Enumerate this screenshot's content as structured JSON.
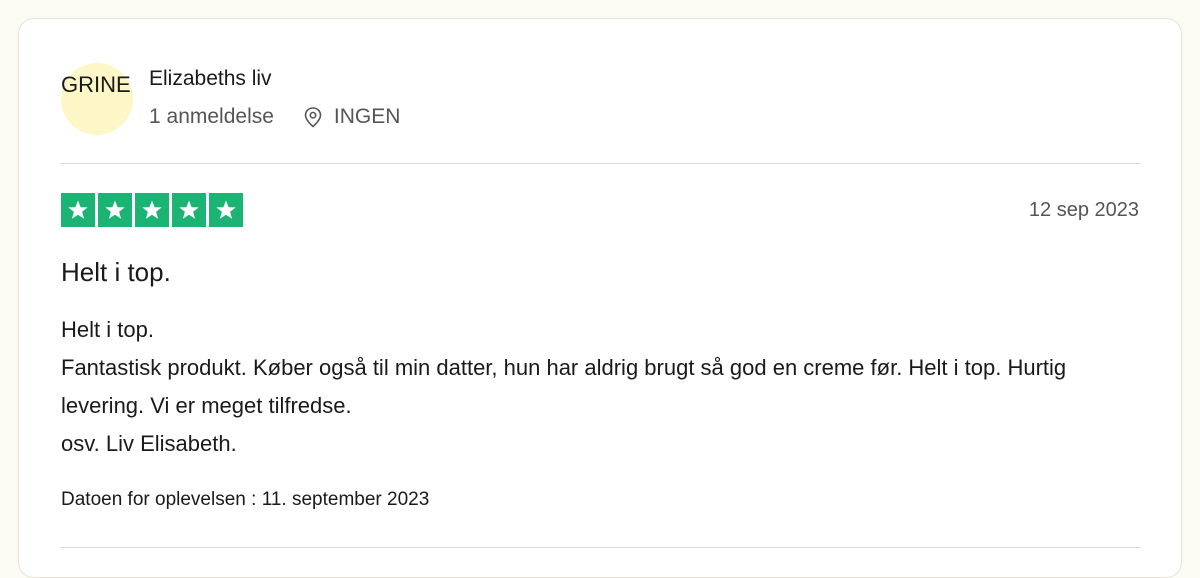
{
  "consumer": {
    "avatar_initials": "GRINE",
    "name": "Elizabeths liv",
    "review_count": "1 anmeldelse",
    "location": "INGEN",
    "location_icon": "location-pin-icon"
  },
  "review": {
    "rating": 5,
    "rating_max": 5,
    "star_color": "#1cb474",
    "date": "12 sep 2023",
    "title": "Helt i top.",
    "body_lines": [
      "Helt i top.",
      "Fantastisk produkt. Køber også til min datter, hun har aldrig brugt så god en creme før. Helt i top. Hurtig levering. Vi er meget tilfredse.",
      "osv. Liv Elisabeth."
    ],
    "experience_label": "Datoen for oplevelsen",
    "experience_date": "11. september 2023"
  }
}
